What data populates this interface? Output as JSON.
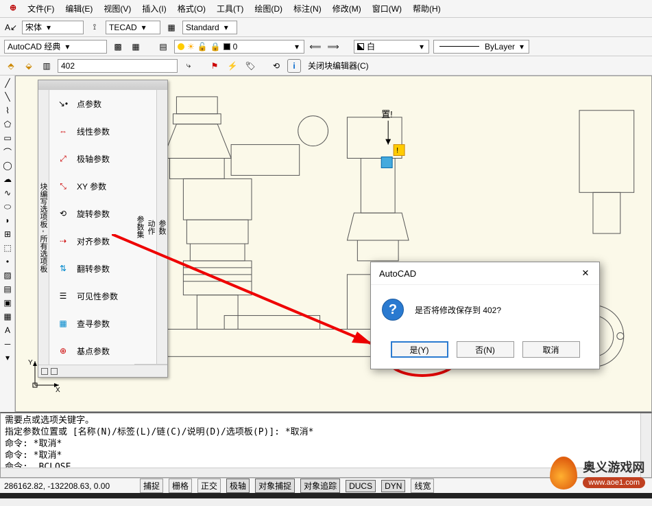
{
  "menu": {
    "file": "文件(F)",
    "edit": "编辑(E)",
    "view": "视图(V)",
    "insert": "插入(I)",
    "format": "格式(O)",
    "tools": "工具(T)",
    "draw": "绘图(D)",
    "dimension": "标注(N)",
    "modify": "修改(M)",
    "window": "窗口(W)",
    "help": "帮助(H)"
  },
  "styles": {
    "font": "宋体",
    "textstyle": "TECAD",
    "dimstyle": "Standard"
  },
  "workspace": "AutoCAD 经典",
  "layer": {
    "name": "0"
  },
  "colorsel": "白",
  "linetype": "ByLayer",
  "block": {
    "name": "402",
    "close_label": "关闭块编辑器(C)"
  },
  "palette": {
    "side": "块编写选项板 - 所有选项板",
    "tabs": {
      "params": "参数",
      "actions": "动作",
      "psets": "参数集"
    },
    "items": {
      "point": "点参数",
      "linear": "线性参数",
      "polar": "极轴参数",
      "xy": "XY 参数",
      "rotation": "旋转参数",
      "alignment": "对齐参数",
      "flip": "翻转参数",
      "visibility": "可见性参数",
      "lookup": "查寻参数",
      "basepoint": "基点参数"
    }
  },
  "marker": "置!",
  "dialog": {
    "title": "AutoCAD",
    "message": "是否将修改保存到 402?",
    "yes": "是(Y)",
    "no": "否(N)",
    "cancel": "取消"
  },
  "command": {
    "l1": "需要点或选项关键字。",
    "l2": "指定参数位置或 [名称(N)/标签(L)/链(C)/说明(D)/选项板(P)]: *取消*",
    "l3": "命令: *取消*",
    "l4": "命令: *取消*",
    "l5": "命令: _BCLOSE"
  },
  "status": {
    "coords": "286162.82, -132208.63, 0.00",
    "snap": "捕捉",
    "grid": "栅格",
    "ortho": "正交",
    "polar": "极轴",
    "osnap": "对象捕捉",
    "otrack": "对象追踪",
    "ducs": "DUCS",
    "dyn": "DYN",
    "lwt": "线宽"
  },
  "logo": {
    "name": "奥义游戏网",
    "url": "www.aoe1.com"
  }
}
